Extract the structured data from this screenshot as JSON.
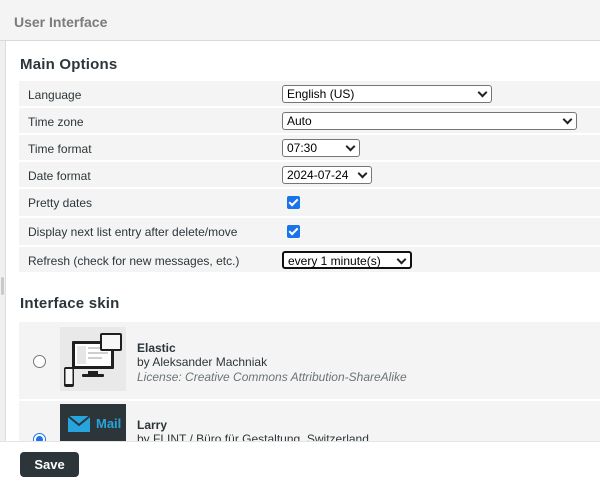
{
  "header": {
    "title": "User Interface"
  },
  "main_options": {
    "title": "Main Options",
    "rows": [
      {
        "label": "Language",
        "value": "English (US)"
      },
      {
        "label": "Time zone",
        "value": "Auto"
      },
      {
        "label": "Time format",
        "value": "07:30"
      },
      {
        "label": "Date format",
        "value": "2024-07-24"
      },
      {
        "label": "Pretty dates",
        "checked": true
      },
      {
        "label": "Display next list entry after delete/move",
        "checked": true
      },
      {
        "label": "Refresh (check for new messages, etc.)",
        "value": "every 1 minute(s)"
      }
    ]
  },
  "interface_skin": {
    "title": "Interface skin",
    "skins": [
      {
        "name": "Elastic",
        "author": "by Aleksander Machniak",
        "license": "License: Creative Commons Attribution-ShareAlike",
        "selected": false
      },
      {
        "name": "Larry",
        "author": "by FLINT / Büro für Gestaltung, Switzerland",
        "logo_text": "Mail",
        "selected": true
      }
    ]
  },
  "footer": {
    "save_label": "Save"
  },
  "colors": {
    "accent": "#1a73e8",
    "button_bg": "#2c363a",
    "row_bg": "#f4f4f4"
  }
}
